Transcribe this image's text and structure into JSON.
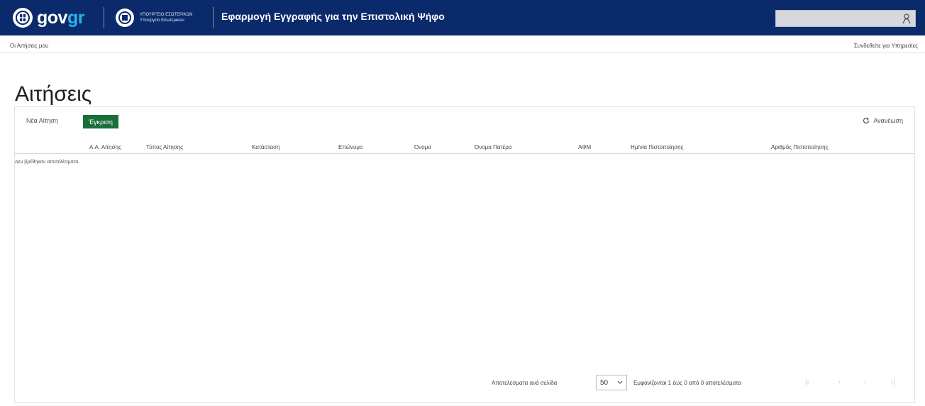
{
  "header": {
    "logo_text_gov": "gov",
    "logo_text_gr": "gr",
    "ministry_line1": "ΥΠΟΥΡΓΕΙΟ ΕΣΩΤΕΡΙΚΩΝ",
    "ministry_line2": "Υπουργείο Εσωτερικών",
    "app_title": "Εφαρμογή Εγγραφής για την Επιστολική Ψήφο",
    "search_placeholder": ""
  },
  "subbar": {
    "breadcrumb": "Οι Αιτήσεις μου",
    "user_link": "Συνδεθείτε για Υπηρεσίες"
  },
  "page": {
    "title": "Αιτήσεις"
  },
  "toolbar": {
    "new_request": "Νέα Αίτηση",
    "search_button": "Έγκριση",
    "refresh": "Ανανέωση"
  },
  "table": {
    "columns": [
      "Α.Α. Αίτησης",
      "Τύπος Αίτησης",
      "Κατάσταση",
      "Επώνυμο",
      "Όνομα",
      "Όνομα Πατέρα",
      "ΑΦΜ",
      "Ημ/νία Πιστοποίησης",
      "Αριθμός Πιστοποίησης"
    ],
    "empty_message": "Δεν βρέθηκαν αποτελέσματα."
  },
  "pager": {
    "per_page_label": "Αποτελέσματα ανά σελίδα",
    "per_page_value": "50",
    "range_text": "Εμφανίζονται 1 έως 0 από 0 αποτελέσματα"
  },
  "colors": {
    "header_bg": "#0b2a6b",
    "accent_green": "#1a6e3a",
    "gr_blue": "#27b5ea"
  }
}
